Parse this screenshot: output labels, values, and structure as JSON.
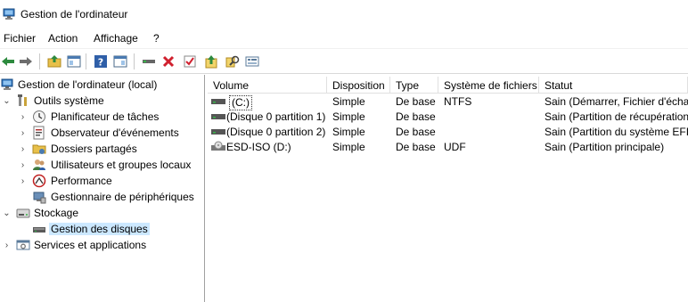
{
  "window": {
    "title": "Gestion de l'ordinateur"
  },
  "menu": {
    "items": [
      "Fichier",
      "Action",
      "Affichage",
      "?"
    ]
  },
  "toolbar": {
    "buttons": [
      "back-arrow-icon",
      "forward-arrow-icon",
      "up-folder-icon",
      "show-hide-tree-icon",
      "help-icon",
      "show-action-pane-icon",
      "connect-icon",
      "delete-icon",
      "properties-icon",
      "export-icon",
      "find-icon",
      "settings-icon"
    ]
  },
  "tree": {
    "root": "Gestion de l'ordinateur (local)",
    "system_tools": "Outils système",
    "task_scheduler": "Planificateur de tâches",
    "event_viewer": "Observateur d'événements",
    "shared_folders": "Dossiers partagés",
    "local_users": "Utilisateurs et groupes locaux",
    "performance": "Performance",
    "device_manager": "Gestionnaire de périphériques",
    "storage": "Stockage",
    "disk_management": "Gestion des disques",
    "services": "Services et applications"
  },
  "table": {
    "columns": [
      "Volume",
      "Disposition",
      "Type",
      "Système de fichiers",
      "Statut"
    ],
    "rows": [
      [
        "(C:)",
        "Simple",
        "De base",
        "NTFS",
        "Sain (Démarrer, Fichier d'écha"
      ],
      [
        "(Disque 0 partition 1)",
        "Simple",
        "De base",
        "",
        "Sain (Partition de récupération"
      ],
      [
        "(Disque 0 partition 2)",
        "Simple",
        "De base",
        "",
        "Sain (Partition du système EFI)"
      ],
      [
        "ESD-ISO (D:)",
        "Simple",
        "De base",
        "UDF",
        "Sain (Partition principale)"
      ]
    ]
  },
  "colors": {
    "selection": "#cce8ff",
    "accent": "#0078d7"
  }
}
